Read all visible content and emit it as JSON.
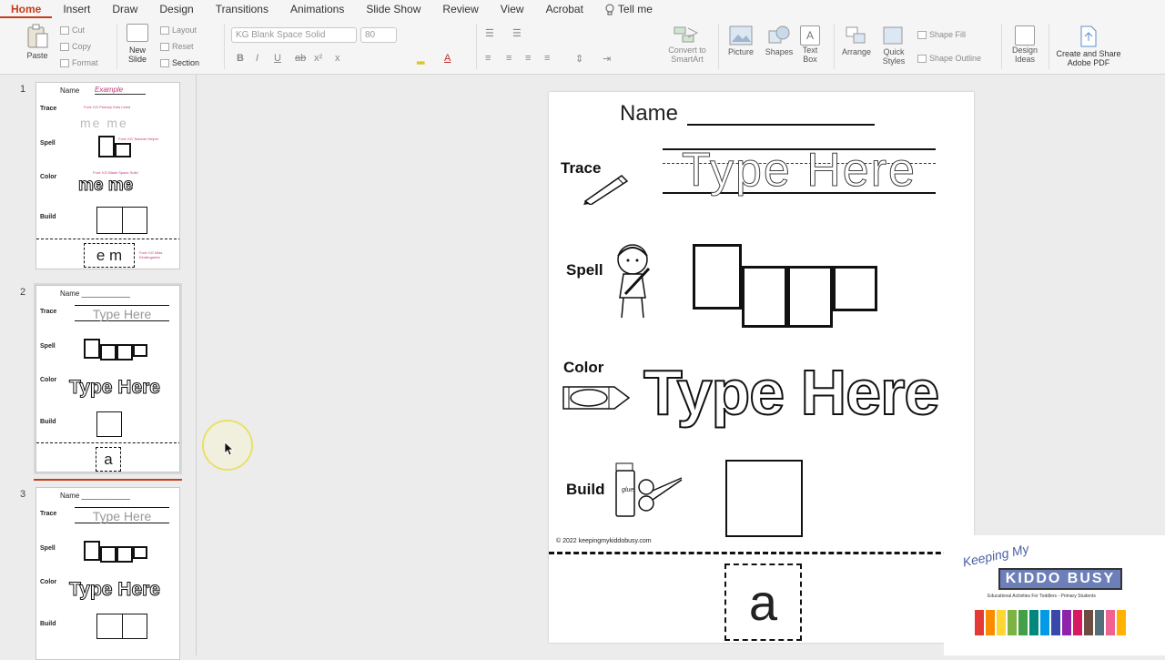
{
  "menu": {
    "tabs": [
      "Home",
      "Insert",
      "Draw",
      "Design",
      "Transitions",
      "Animations",
      "Slide Show",
      "Review",
      "View",
      "Acrobat"
    ],
    "tell_me": "Tell me"
  },
  "ribbon": {
    "paste": "Paste",
    "cut": "Cut",
    "copy": "Copy",
    "format": "Format",
    "new_slide_line1": "New",
    "new_slide_line2": "Slide",
    "layout": "Layout",
    "reset": "Reset",
    "section": "Section",
    "font_name": "KG Blank Space Solid",
    "font_size": "80",
    "convert_line1": "Convert to",
    "convert_line2": "SmartArt",
    "picture": "Picture",
    "shapes": "Shapes",
    "textbox_line1": "Text",
    "textbox_line2": "Box",
    "arrange": "Arrange",
    "quick_line1": "Quick",
    "quick_line2": "Styles",
    "shape_fill": "Shape Fill",
    "shape_outline": "Shape Outline",
    "design_line1": "Design",
    "design_line2": "Ideas",
    "create_line1": "Create and Share",
    "create_line2": "Adobe PDF"
  },
  "thumbnails": [
    {
      "number": "1",
      "name": "Name",
      "example": "Example",
      "trace": "Trace",
      "spell": "Spell",
      "color": "Color",
      "build": "Build",
      "font_note1": "Font: KG Primary Dots Lined",
      "font_note2": "Font: KG Teacher Helper",
      "font_note3": "Font: KG Blank Space Solid",
      "font_note4": "Font: KG Miss Kindergarten",
      "trace_word": "me  me",
      "color_word": "me   me",
      "letters": "e m"
    },
    {
      "number": "2",
      "name": "Name ____________",
      "trace": "Trace",
      "spell": "Spell",
      "color": "Color",
      "build": "Build",
      "trace_word": "Type Here",
      "color_word": "Type Here",
      "letter": "a"
    },
    {
      "number": "3",
      "name": "Name ____________",
      "trace": "Trace",
      "spell": "Spell",
      "color": "Color",
      "build": "Build",
      "trace_word": "Type Here",
      "color_word": "Type Here"
    }
  ],
  "slide": {
    "name_label": "Name",
    "trace_label": "Trace",
    "trace_word": "Type Here",
    "spell_label": "Spell",
    "color_label": "Color",
    "color_word": "Type Here",
    "build_label": "Build",
    "copyright": "© 2022 keepingmykiddobusy.com",
    "cut_letter": "a",
    "glue_text": "glue"
  },
  "logo": {
    "line1": "Keeping My",
    "kiddo": "KIDDO BUSY",
    "tagline": "Educational Activities For Toddlers - Primary Students"
  }
}
